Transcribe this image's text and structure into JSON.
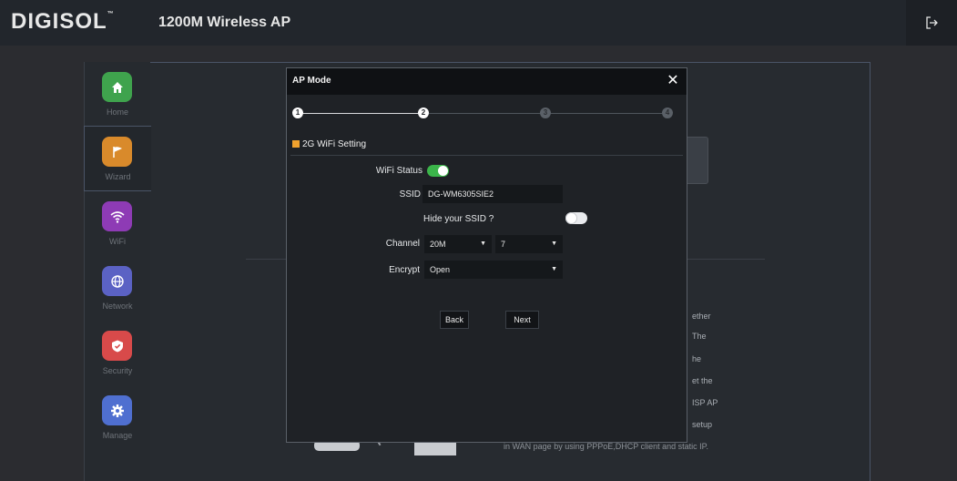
{
  "header": {
    "brand": "DIGISOL",
    "brand_mark": "™",
    "title": "1200M Wireless AP",
    "logout_icon": "logout-icon"
  },
  "sidebar": {
    "items": [
      {
        "label": "Home",
        "icon": "home-icon",
        "color": "#3fa34d"
      },
      {
        "label": "Wizard",
        "icon": "flag-icon",
        "color": "#d98a2b"
      },
      {
        "label": "WiFi",
        "icon": "wifi-icon",
        "color": "#8e3bb5"
      },
      {
        "label": "Network",
        "icon": "globe-icon",
        "color": "#5b62c4"
      },
      {
        "label": "Security",
        "icon": "shield-icon",
        "color": "#d84a4a"
      },
      {
        "label": "Manage",
        "icon": "gear-icon",
        "color": "#4f6fd0"
      }
    ],
    "active": "Wizard"
  },
  "background_text": [
    "ether",
    "The",
    "he",
    "et the",
    "ISP AP",
    "setup",
    "in WAN page by using PPPoE,DHCP client and static IP."
  ],
  "modal": {
    "title": "AP Mode",
    "close_label": "✕",
    "steps": [
      "1",
      "2",
      "3",
      "4"
    ],
    "current_step": 2,
    "section_title": "2G WiFi Setting",
    "wifi_status_label": "WiFi Status",
    "wifi_status_on": true,
    "ssid_label": "SSID",
    "ssid_value": "DG-WM6305SIE2",
    "hide_ssid_label": "Hide your SSID ?",
    "hide_ssid_on": false,
    "channel_label": "Channel",
    "channel_width": "20M",
    "channel_number": "7",
    "encrypt_label": "Encrypt",
    "encrypt_value": "Open",
    "back_label": "Back",
    "next_label": "Next"
  },
  "colors": {
    "accent_orange": "#f0a22e",
    "toggle_on": "#3bb54a"
  }
}
